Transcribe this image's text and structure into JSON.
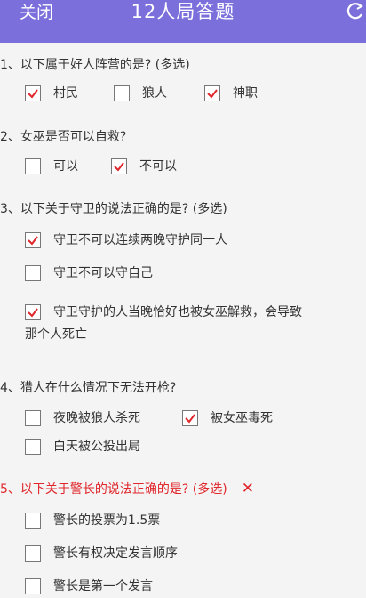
{
  "header": {
    "close_label": "关闭",
    "title": "12人局答题"
  },
  "colors": {
    "header_bg": "#7b6fdc",
    "check": "#e0262b",
    "wrong_text": "#e0262b"
  },
  "questions": [
    {
      "text": "1、以下属于好人阵营的是? (多选)",
      "options": [
        {
          "label": "村民",
          "checked": true
        },
        {
          "label": "狼人",
          "checked": false
        },
        {
          "label": "神职",
          "checked": true
        }
      ]
    },
    {
      "text": "2、女巫是否可以自救?",
      "options": [
        {
          "label": "可以",
          "checked": false
        },
        {
          "label": "不可以",
          "checked": true
        }
      ]
    },
    {
      "text": "3、以下关于守卫的说法正确的是? (多选)",
      "options": [
        {
          "label": "守卫不可以连续两晚守护同一人",
          "checked": true
        },
        {
          "label": "守卫不可以守自己",
          "checked": false
        },
        {
          "label": "守卫守护的人当晚恰好也被女巫解救，会导致",
          "continuation": "那个人死亡",
          "checked": true
        }
      ]
    },
    {
      "text": "4、猎人在什么情况下无法开枪?",
      "options": [
        {
          "label": "夜晚被狼人杀死",
          "checked": false
        },
        {
          "label": "被女巫毒死",
          "checked": true
        },
        {
          "label": "白天被公投出局",
          "checked": false
        }
      ]
    },
    {
      "text": "5、以下关于警长的说法正确的是? (多选)",
      "wrong": true,
      "wrong_mark": "✕",
      "options": [
        {
          "label": "警长的投票为1.5票",
          "checked": false
        },
        {
          "label": "警长有权决定发言顺序",
          "checked": false
        },
        {
          "label": "警长是第一个发言",
          "checked": false
        }
      ]
    }
  ]
}
